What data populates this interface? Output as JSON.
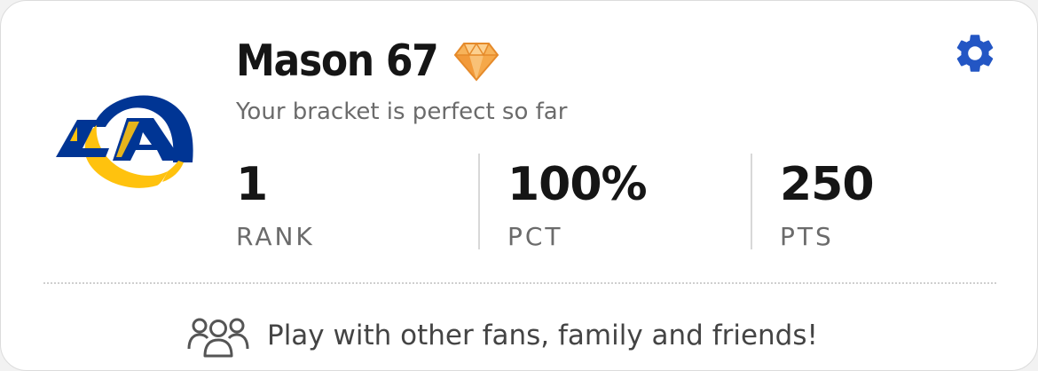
{
  "profile": {
    "username": "Mason 67",
    "subtitle": "Your bracket is perfect so far",
    "badge_icon": "diamond-gem-icon",
    "team_logo": "los-angeles-rams-logo",
    "logo_text": "LA"
  },
  "stats": [
    {
      "value": "1",
      "label": "RANK"
    },
    {
      "value": "100%",
      "label": "PCT"
    },
    {
      "value": "250",
      "label": "PTS"
    }
  ],
  "settings": {
    "icon": "gear-icon"
  },
  "invite": {
    "icon": "people-group-icon",
    "text": "Play with other fans, family and friends!"
  },
  "colors": {
    "rams_blue": "#003594",
    "rams_gold": "#FFC20E",
    "settings_blue": "#2356c4",
    "text_dark": "#151515",
    "text_muted": "#6b6b6b"
  }
}
